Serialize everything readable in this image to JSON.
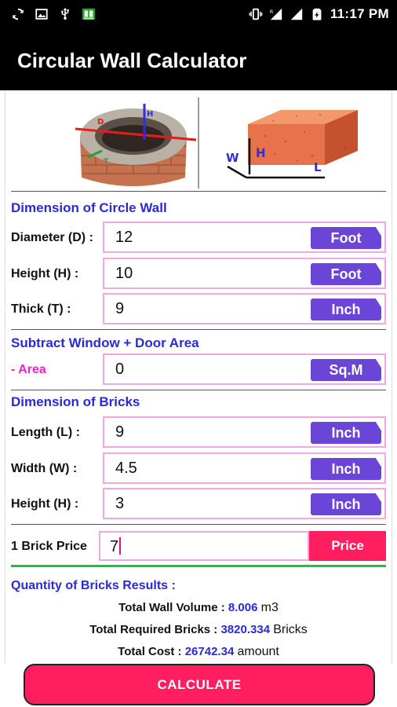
{
  "status_bar": {
    "time": "11:17 PM",
    "left_icons": [
      "sync-icon",
      "image-icon",
      "usb-icon",
      "book-app-icon"
    ],
    "right_icons": [
      "vibrate-icon",
      "signal-r-icon",
      "signal-icon",
      "battery-charging-icon"
    ]
  },
  "app": {
    "title": "Circular Wall Calculator"
  },
  "illustrations": {
    "wall_labels": {
      "d": "D",
      "h": "H",
      "t": "T"
    },
    "brick_labels": {
      "w": "W",
      "h": "H",
      "l": "L"
    }
  },
  "circle_wall": {
    "section_title": "Dimension of  Circle Wall",
    "diameter": {
      "label": "Diameter (D) :",
      "value": "12",
      "unit": "Foot"
    },
    "height": {
      "label": "Height (H) :",
      "value": "10",
      "unit": "Foot"
    },
    "thick": {
      "label": "Thick (T) :",
      "value": "9",
      "unit": "Inch"
    }
  },
  "subtract": {
    "section_title": "Subtract Window + Door Area",
    "area": {
      "label": "- Area",
      "value": "0",
      "unit": "Sq.M"
    }
  },
  "bricks": {
    "section_title": "Dimension of Bricks",
    "length": {
      "label": "Length (L) :",
      "value": "9",
      "unit": "Inch"
    },
    "width": {
      "label": "Width (W) :",
      "value": "4.5",
      "unit": "Inch"
    },
    "height": {
      "label": "Height (H) :",
      "value": "3",
      "unit": "Inch"
    }
  },
  "price": {
    "label": "1 Brick Price",
    "value": "7",
    "button": "Price"
  },
  "results": {
    "section_title": "Quantity of Bricks Results :",
    "volume": {
      "label": "Total Wall Volume :",
      "value": "8.006",
      "unit": "m3"
    },
    "bricks": {
      "label": "Total Required Bricks :",
      "value": "3820.334",
      "unit": "Bricks"
    },
    "cost": {
      "label": "Total Cost :",
      "value": "26742.34",
      "unit": "amount"
    }
  },
  "calculate_button": "CALCULATE",
  "colors": {
    "accent_blue": "#2a2ad8",
    "unit_button": "#6a45d8",
    "pink_button": "#ff1f61",
    "field_border": "#f0a8e0",
    "divider_green": "#19c63a"
  }
}
